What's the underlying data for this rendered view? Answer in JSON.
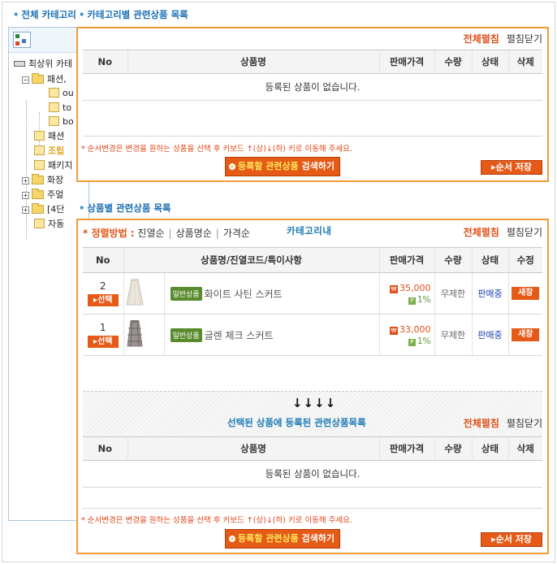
{
  "header": {
    "all_category": "전체 카테고리",
    "category_related": "카테고리별 관련상품 목록",
    "product_related": "상품별 관련상품 목록"
  },
  "tree": {
    "items": [
      {
        "label": "최상위 카테"
      },
      {
        "label": "패션,"
      },
      {
        "label": "ou"
      },
      {
        "label": "to"
      },
      {
        "label": "bo"
      },
      {
        "label": "패션"
      },
      {
        "label": "조립"
      },
      {
        "label": "패키지"
      },
      {
        "label": "화장"
      },
      {
        "label": "주얼"
      },
      {
        "label": "[4단"
      },
      {
        "label": "자동"
      }
    ]
  },
  "panel_top": {
    "open_all": "전체펼침",
    "close_all": "펼침닫기",
    "columns": [
      "No",
      "상품명",
      "판매가격",
      "수량",
      "상태",
      "삭제"
    ],
    "empty": "등록된 상품이 없습니다.",
    "notice": "* 순서변경은 변경을 원하는 상품을 선택 후 키보드 ↑(상)↓(하) 키로 이동해 주세요.",
    "search_btn_icon": "magnifier-icon",
    "search_btn_highlight": "등록할 관련상품",
    "search_btn_rest": "검색하기",
    "save_btn": "순서 저장"
  },
  "panel_bottom": {
    "sort_label": "정렬방법 :",
    "sort_options": [
      "진열순",
      "상품명순",
      "가격순"
    ],
    "category_in": "카테고리내",
    "open_all": "전체펼침",
    "close_all": "펼침닫기",
    "columns": [
      "No",
      "상품명/진열코드/특이사항",
      "판매가격",
      "수량",
      "상태",
      "수정"
    ],
    "select_btn": "선택",
    "edit_btn": "새창",
    "products": [
      {
        "no": "2",
        "badge": "일반상품",
        "name": "화이트 사틴 스커트",
        "price": "35,000",
        "point": "1%",
        "qty": "무제한",
        "status": "판매중"
      },
      {
        "no": "1",
        "badge": "일반상품",
        "name": "글렌 체크 스커트",
        "price": "33,000",
        "point": "1%",
        "qty": "무제한",
        "status": "판매중"
      }
    ],
    "arrows": "↓↓↓↓",
    "registered_title": "선택된 상품에 등록된 관련상품목록",
    "open_all_2": "전체펼침",
    "close_all_2": "펼침닫기",
    "columns2": [
      "No",
      "상품명",
      "판매가격",
      "수량",
      "상태",
      "삭제"
    ],
    "empty": "등록된 상품이 없습니다.",
    "notice": "* 순서변경은 변경을 원하는 상품을 선택 후 키보드 ↑(상)↓(하) 키로 이동해 주세요.",
    "search_btn_highlight": "등록할 관련상품",
    "search_btn_rest": "검색하기",
    "save_btn": "순서 저장"
  }
}
